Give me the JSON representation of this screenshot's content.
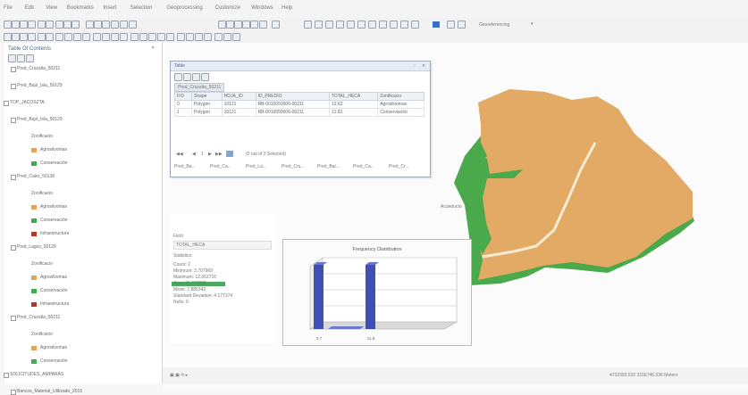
{
  "menus": [
    "File",
    "Edit",
    "View",
    "Bookmarks",
    "Insert",
    "Selection",
    "Geoprocessing",
    "Customize",
    "Windows",
    "Help"
  ],
  "georeferencing_label": "Georeferencing",
  "toc": {
    "title": "Table Of Contents",
    "items": [
      {
        "label": "Pred_Cruzalta_50211",
        "indent": 1,
        "type": "layer"
      },
      {
        "label": "Pred_Bajo_Isla_50129",
        "indent": 1,
        "type": "layer"
      },
      {
        "label": "TOP_JACOSZTA",
        "indent": 0,
        "type": "group"
      },
      {
        "label": "Pred_Bajo_Isla_50129",
        "indent": 1,
        "type": "layer"
      },
      {
        "label": "Zonificacio",
        "indent": 3,
        "type": "field"
      },
      {
        "label": "Agrosilvomax",
        "indent": 3,
        "type": "legend",
        "color": "#e0a45a"
      },
      {
        "label": "Conservación",
        "indent": 3,
        "type": "legend",
        "color": "#3fae49"
      },
      {
        "label": "Pred_Cairo_50138",
        "indent": 1,
        "type": "layer"
      },
      {
        "label": "Zonificacio",
        "indent": 3,
        "type": "field"
      },
      {
        "label": "Agrosilvomax",
        "indent": 3,
        "type": "legend",
        "color": "#e0a45a"
      },
      {
        "label": "Conservación",
        "indent": 3,
        "type": "legend",
        "color": "#3fae49"
      },
      {
        "label": "Infraestructura",
        "indent": 3,
        "type": "legend",
        "color": "#b3362b"
      },
      {
        "label": "Pred_Lagos_50129",
        "indent": 1,
        "type": "layer"
      },
      {
        "label": "Zonificacio",
        "indent": 3,
        "type": "field"
      },
      {
        "label": "Agrosilvomax",
        "indent": 3,
        "type": "legend",
        "color": "#e0a45a"
      },
      {
        "label": "Conservación",
        "indent": 3,
        "type": "legend",
        "color": "#3fae49"
      },
      {
        "label": "Infraestructura",
        "indent": 3,
        "type": "legend",
        "color": "#b3362b"
      },
      {
        "label": "Pred_Cruzalta_50211",
        "indent": 1,
        "type": "layer"
      },
      {
        "label": "Zonificacio",
        "indent": 3,
        "type": "field"
      },
      {
        "label": "Agrosilvomax",
        "indent": 3,
        "type": "legend",
        "color": "#e0a45a"
      },
      {
        "label": "Conservación",
        "indent": 3,
        "type": "legend",
        "color": "#3fae49"
      },
      {
        "label": "SOLICITUDES_AMPARAS",
        "indent": 0,
        "type": "group"
      },
      {
        "label": "Bancos_Material_Utilizado_2015",
        "indent": 1,
        "type": "layer"
      }
    ]
  },
  "table_window": {
    "title": "Table",
    "tab_label": "Pred_Cruzalta_50211",
    "columns": [
      "FID",
      "Shape",
      "HOJA_ID",
      "ID_PREDIO",
      "TOTAL_HECA",
      "Zonificacio"
    ],
    "rows": [
      [
        "0",
        "Polygon",
        "10121",
        "RB-0010050006-00211",
        "12.62",
        "Agrosilvomax"
      ],
      [
        "1",
        "Polygon",
        "10121",
        "RB-0010050006-00211",
        "12.81",
        "Conservación"
      ]
    ],
    "selection_status": "(0 out of 2 Selected)",
    "page_value": "1",
    "tabs": [
      "Pred_Ba...",
      "Pred_Ca...",
      "Pred_La...",
      "Pred_Cru...",
      "Pred_Bal...",
      "Pred_Ca...",
      "Pred_Cr..."
    ]
  },
  "stats": {
    "field_label": "Field",
    "field_value": "TOTAL_HECA",
    "section": "Statistics:",
    "lines": [
      "Count: 2",
      "Minimum: 3.707969",
      "Maximum: 12.062716",
      "Sum: 15.770685",
      "Mean: 7.885342",
      "Standard Deviation: 4.177374",
      "Nulls: 0"
    ]
  },
  "chart_data": {
    "type": "bar",
    "title": "Frequency Distribution",
    "categories": [
      "3.7",
      "11.8"
    ],
    "values": [
      1,
      1
    ],
    "ylim": [
      0,
      1
    ]
  },
  "map_label": "Acueducto",
  "coordinates": "4732393.532 2156746.536 Meters",
  "colors": {
    "agro": "#e3aa66",
    "conservacion": "#4aa94a",
    "infra": "#b3362b",
    "road": "#f3ebd2",
    "bar": "#3f4fb4",
    "title": "#4a6a8d"
  }
}
